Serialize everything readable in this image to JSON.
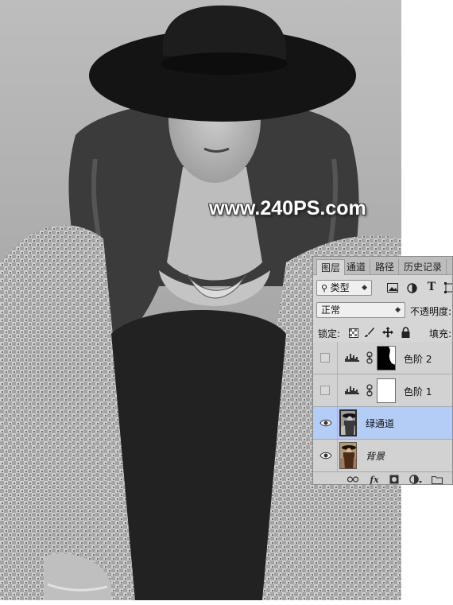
{
  "watermark": {
    "text": "www.240PS.com"
  },
  "layers_panel": {
    "tabs": [
      {
        "label": "图层",
        "active": true
      },
      {
        "label": "通道",
        "active": false
      },
      {
        "label": "路径",
        "active": false
      },
      {
        "label": "历史记录",
        "active": false
      }
    ],
    "filter": {
      "label": "类型"
    },
    "blend_mode": {
      "value": "正常"
    },
    "opacity_label": "不透明度:",
    "lock_label": "锁定:",
    "fill_label": "填充:",
    "layers": [
      {
        "name": "色阶 2",
        "type": "adjustment-levels",
        "visible": false,
        "mask": "dark",
        "selected": false
      },
      {
        "name": "色阶 1",
        "type": "adjustment-levels",
        "visible": false,
        "mask": "white",
        "selected": false
      },
      {
        "name": "绿通道",
        "type": "image",
        "visible": true,
        "thumbnail": "grayscale",
        "selected": true
      },
      {
        "name": "背景",
        "type": "image",
        "visible": true,
        "thumbnail": "color",
        "selected": false,
        "italic": true
      }
    ],
    "footer_icons": [
      "link-icon",
      "fx-icon",
      "mask-icon",
      "adjustment-icon",
      "folder-icon"
    ],
    "footer_fx": "fx"
  },
  "colors": {
    "selection": "#b3cdf7",
    "panel_bg": "#d6d6d6"
  }
}
